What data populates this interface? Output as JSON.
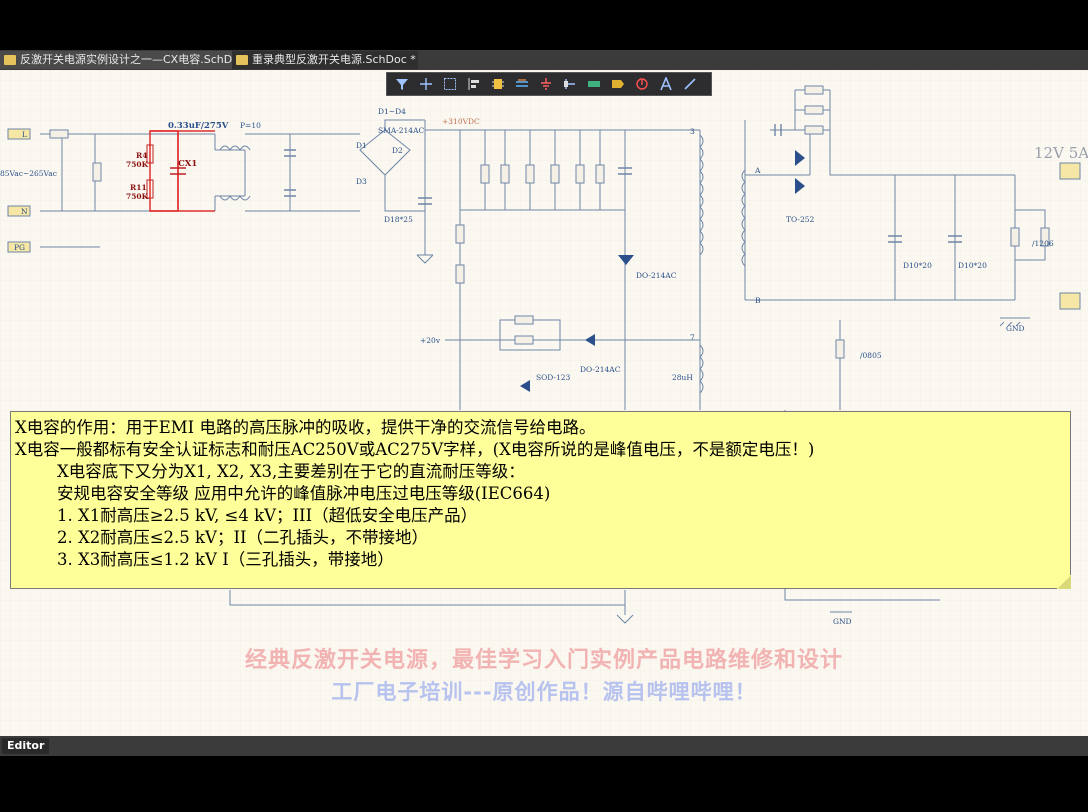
{
  "tabs": [
    {
      "label": "反激开关电源实例设计之一—CX电容.SchDoc *"
    },
    {
      "label": "重录典型反激开关电源.SchDoc *"
    }
  ],
  "toolbar": {
    "icons": [
      "filter-icon",
      "crosshair-icon",
      "select-rect-icon",
      "align-icon",
      "component-icon",
      "net-label-icon",
      "ground-icon",
      "port-icon",
      "bus-icon",
      "sheet-entry-icon",
      "power-icon",
      "text-icon",
      "line-icon"
    ]
  },
  "schematic": {
    "label_cap": "0.33uF/275V",
    "label_p10": "P=10",
    "label_d1d4": "D1~D4",
    "label_sma": "SMA-214AC",
    "label_vdc": "+310VDC",
    "label_r4": "R4",
    "label_r4v": "750K",
    "label_r11": "R11",
    "label_r11v": "750K",
    "label_cx1": "CX1",
    "label_ac": "85Vac~265Vac",
    "label_l": "L",
    "label_n": "N",
    "label_pg": "PG",
    "label_d1": "D1",
    "label_d2": "D2",
    "label_d3": "D3",
    "label_d1825": "D18*25",
    "label_12v": "12V 5A",
    "label_to252": "TO-252",
    "label_a": "A",
    "label_b": "B",
    "label_d1020a": "D10*20",
    "label_d1020b": "D10*20",
    "label_gnd": "GND",
    "label_do214a": "DO-214AC",
    "label_do214b": "DO-214AC",
    "label_sod": "SOD-123",
    "label_0805": "/0805",
    "label_1206": "/1206",
    "label_28uh": "28uH",
    "label_3": "3",
    "label_7": "7",
    "label_gnd2": "GND",
    "label_20v": "+20v"
  },
  "note": {
    "line1": "X电容的作用：用于EMI 电路的高压脉冲的吸收，提供干净的交流信号给电路。",
    "line2": "X电容一般都标有安全认证标志和耐压AC250V或AC275V字样，(X电容所说的是峰值电压，不是额定电压！)",
    "line3": "X电容底下又分为X1, X2, X3,主要差别在于它的直流耐压等级：",
    "line4": "安规电容安全等级 应用中允许的峰值脉冲电压过电压等级(IEC664)",
    "line5": "1. X1耐高压≥2.5 kV, ≤4 kV；III（超低安全电压产品）",
    "line6": "2. X2耐高压≤2.5 kV；II（二孔插头，不带接地）",
    "line7": "3. X3耐高压≤1.2 kV I（三孔插头，带接地）"
  },
  "watermark": {
    "line1": "经典反激开关电源，最佳学习入门实例产品电路维修和设计",
    "line2": "工厂电子培训---原创作品！源自哔哩哔哩！"
  },
  "status": {
    "editor_label": "Editor"
  }
}
